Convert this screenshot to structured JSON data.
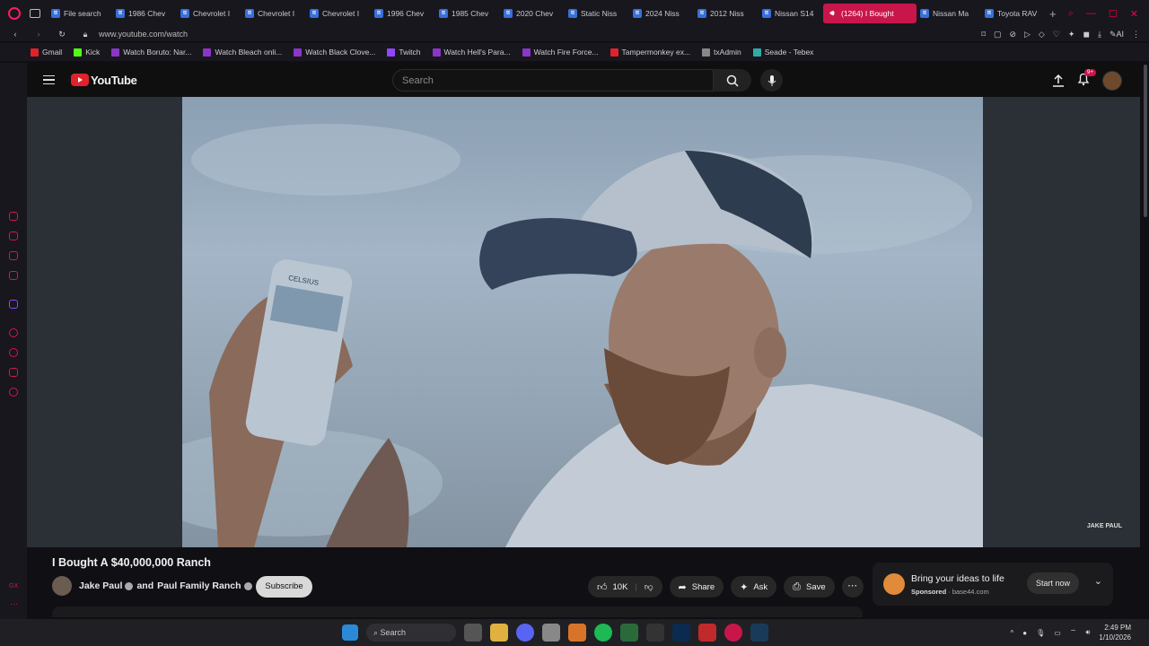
{
  "browser": {
    "tabs": [
      {
        "label": "File search"
      },
      {
        "label": "1986 Chev"
      },
      {
        "label": "Chevrolet I"
      },
      {
        "label": "Chevrolet I"
      },
      {
        "label": "Chevrolet I"
      },
      {
        "label": "1996 Chev"
      },
      {
        "label": "1985 Chev"
      },
      {
        "label": "2020 Chev"
      },
      {
        "label": "Static Niss"
      },
      {
        "label": "2024 Niss"
      },
      {
        "label": "2012 Niss"
      },
      {
        "label": "Nissan S14"
      },
      {
        "label": "(1264) I Bought",
        "active": true
      },
      {
        "label": "Nissan Ma"
      },
      {
        "label": "Toyota RAV"
      }
    ],
    "new_tab": "+",
    "url": "www.youtube.com/watch",
    "ai_label": "AI",
    "bookmarks": [
      {
        "label": "Gmail",
        "color": "#e1222b"
      },
      {
        "label": "Kick",
        "color": "#53fc18"
      },
      {
        "label": "Watch Boruto: Nar...",
        "color": "#8a36c8"
      },
      {
        "label": "Watch Bleach onli...",
        "color": "#8a36c8"
      },
      {
        "label": "Watch Black Clove...",
        "color": "#8a36c8"
      },
      {
        "label": "Twitch",
        "color": "#9146ff"
      },
      {
        "label": "Watch Hell's Para...",
        "color": "#8a36c8"
      },
      {
        "label": "Watch Fire Force...",
        "color": "#8a36c8"
      },
      {
        "label": "Tampermonkey ex...",
        "color": "#e1222b"
      },
      {
        "label": "txAdmin",
        "color": "#888888"
      },
      {
        "label": "Seade - Tebex",
        "color": "#3aa"
      }
    ]
  },
  "youtube": {
    "logo_text": "YouTube",
    "search_placeholder": "Search",
    "notification_badge": "9+",
    "video_watermark": "JAKE PAUL",
    "can_text": "CELSIUS",
    "video_title": "I Bought A $40,000,000 Ranch",
    "channel_name": "Jake Paul",
    "channel_joiner": "and",
    "channel_collab": "Paul Family Ranch",
    "subscribe_label": "Subscribe",
    "likes": "10K",
    "share_label": "Share",
    "ask_label": "Ask",
    "save_label": "Save",
    "ad": {
      "title": "Bring your ideas to life",
      "sponsored": "Sponsored",
      "domain": "base44.com",
      "cta": "Start now"
    }
  },
  "taskbar": {
    "search_label": "Search",
    "time": "2:49 PM",
    "date": "1/10/2026"
  },
  "colors": {
    "accent": "#c8164b",
    "yt_red": "#e1222b",
    "background": "#0f0f14"
  }
}
